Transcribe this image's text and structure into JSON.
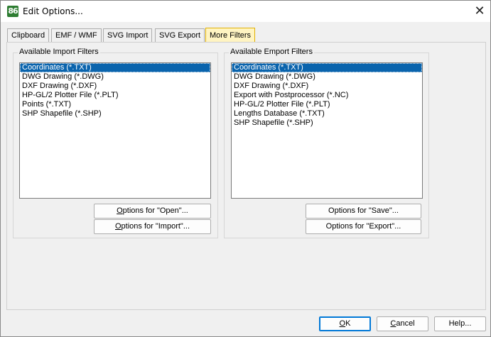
{
  "window": {
    "title": "Edit Options...",
    "app_icon": "86"
  },
  "tabs": [
    {
      "label": "Clipboard",
      "active": false
    },
    {
      "label": "EMF / WMF",
      "active": false
    },
    {
      "label": "SVG Import",
      "active": false
    },
    {
      "label": "SVG Export",
      "active": false
    },
    {
      "label": "More Filters",
      "active": true
    }
  ],
  "import_group": {
    "title": "Available Import Filters",
    "items": [
      "Coordinates (*.TXT)",
      "DWG Drawing (*.DWG)",
      "DXF Drawing (*.DXF)",
      "HP-GL/2 Plotter File (*.PLT)",
      "Points (*.TXT)",
      "SHP Shapefile (*.SHP)"
    ],
    "selected_index": 0,
    "buttons": [
      {
        "pre": "",
        "ul": "O",
        "post": "ptions for \"Open\"..."
      },
      {
        "pre": "",
        "ul": "O",
        "post": "ptions for \"Import\"..."
      }
    ]
  },
  "export_group": {
    "title": "Available Emport Filters",
    "items": [
      "Coordinates (*.TXT)",
      "DWG Drawing (*.DWG)",
      "DXF Drawing (*.DXF)",
      "Export with Postprocessor (*.NC)",
      "HP-GL/2 Plotter File (*.PLT)",
      "Lengths Database (*.TXT)",
      "SHP Shapefile (*.SHP)"
    ],
    "selected_index": 0,
    "buttons": [
      {
        "pre": "Options for \"Save\"...",
        "ul": "",
        "post": ""
      },
      {
        "pre": "Options for \"Export\"...",
        "ul": "",
        "post": ""
      }
    ]
  },
  "footer": {
    "ok": {
      "ul": "O",
      "post": "K"
    },
    "cancel": {
      "ul": "C",
      "post": "ancel"
    },
    "help": "Help..."
  },
  "colors": {
    "selection": "#0a64ad",
    "active_tab": "#fff4c2",
    "default_button_border": "#0078d7"
  }
}
